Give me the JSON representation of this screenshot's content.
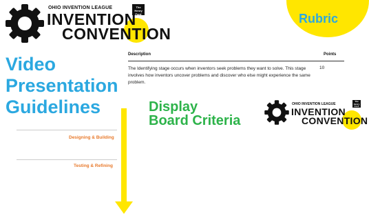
{
  "logo": {
    "small": "OHIO INVENTION LEAGUE",
    "line1": "INVENTION",
    "line2": "CONVENTION",
    "ford": "The Henry Ford"
  },
  "rubric": {
    "label": "Rubric",
    "col_description": "Description",
    "col_points": "Points",
    "rows": [
      {
        "description": "The Identifying stage occurs when inventors seek problems they want to solve. This stage involves how inventors uncover problems and discover who else might experience the same problem.",
        "points": "10"
      }
    ]
  },
  "video": {
    "title_line1": "Video",
    "title_line2": "Presentation",
    "title_line3": "Guidelines"
  },
  "stages": [
    {
      "label": "Designing & Building"
    },
    {
      "label": "Testing & Refining"
    }
  ],
  "display": {
    "title_line1": "Display",
    "title_line2": "Board Criteria"
  },
  "colors": {
    "yellow": "#FFE600",
    "blue": "#2BA8E0",
    "green": "#2DB34A",
    "orange": "#E8792B"
  }
}
